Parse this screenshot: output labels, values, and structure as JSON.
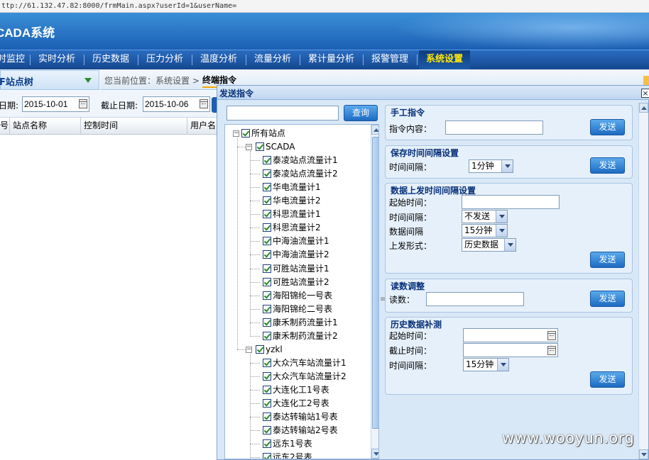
{
  "browser": {
    "url": "ttp://61.132.47.82:8000/frmMain.aspx?userId=1&userName="
  },
  "app": {
    "title": "CADA系统"
  },
  "nav": {
    "items": [
      {
        "label": "时监控"
      },
      {
        "label": "实时分析"
      },
      {
        "label": "历史数据"
      },
      {
        "label": "压力分析"
      },
      {
        "label": "温度分析"
      },
      {
        "label": "流量分析"
      },
      {
        "label": "累计量分析"
      },
      {
        "label": "报警管理"
      },
      {
        "label": "系统设置"
      }
    ],
    "active_index": 8
  },
  "left": {
    "panel_title": "F站点树",
    "start_label": "日期:",
    "start_date": "2015-10-01",
    "end_label": "截止日期:",
    "end_date": "2015-10-06",
    "columns": [
      "号",
      "站点名称",
      "控制时间",
      "用户名"
    ]
  },
  "breadcrumb": {
    "position_label": "您当前位置：系统设置 >",
    "current": "终端指令"
  },
  "dialog": {
    "title": "发送指令",
    "close": "×",
    "search_button": "查询",
    "search_value": "",
    "tree": {
      "root": "所有站点",
      "groups": [
        {
          "name": "SCADA",
          "items": [
            "泰凌站点流量计1",
            "泰凌站点流量计2",
            "华电流量计1",
            "华电流量计2",
            "科思流量计1",
            "科思流量计2",
            "中海油流量计1",
            "中海油流量计2",
            "可胜站流量计1",
            "可胜站流量计2",
            "海阳锦纶一号表",
            "海阳锦纶二号表",
            "康禾制药流量计1",
            "康禾制药流量计2"
          ]
        },
        {
          "name": "yzkl",
          "items": [
            "大众汽车站流量计1",
            "大众汽车站流量计2",
            "大连化工1号表",
            "大连化工2号表",
            "泰达转输站1号表",
            "泰达转输站2号表",
            "远东1号表",
            "远东2号表"
          ]
        }
      ]
    },
    "send_label": "发送",
    "manual": {
      "title": "手工指令",
      "content_label": "指令内容：",
      "content_value": ""
    },
    "save_interval": {
      "title": "保存时间间隔设置",
      "interval_label": "时间间隔：",
      "interval_value": "1分钟"
    },
    "upload": {
      "title": "数据上发时间间隔设置",
      "start_label": "起始时间：",
      "start_value": "",
      "interval_label": "时间间隔：",
      "interval_value": "不发送",
      "data_interval_label": "数据间隔",
      "data_interval_value": "15分钟",
      "form_label": "上发形式：",
      "form_value": "历史数据"
    },
    "reading": {
      "title": "读数调整",
      "label": "读数：",
      "value": ""
    },
    "history": {
      "title": "历史数据补测",
      "start_label": "起始时间：",
      "start_value": "",
      "end_label": "截止时间：",
      "end_value": "",
      "interval_label": "时间间隔：",
      "interval_value": "15分钟"
    }
  },
  "watermark": "www.wooyun.org"
}
